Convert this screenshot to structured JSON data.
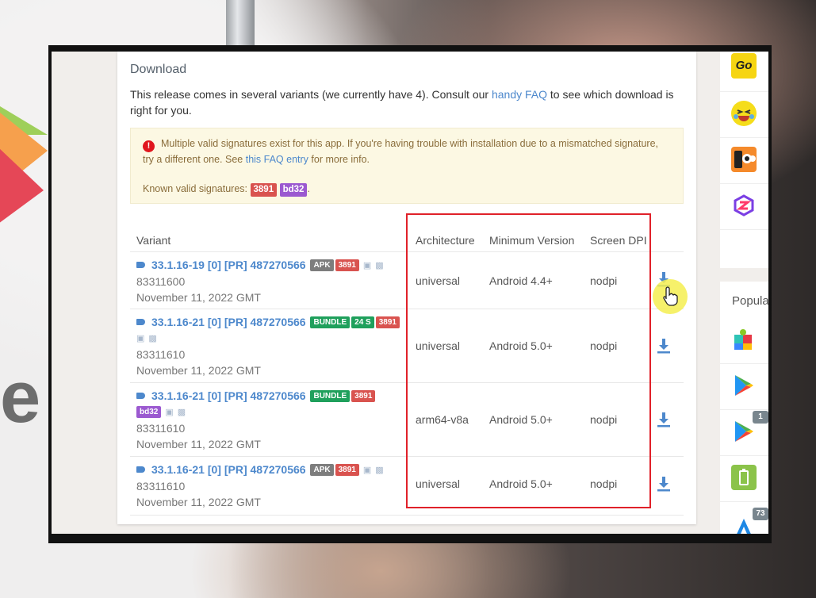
{
  "download": {
    "title": "Download",
    "intro_pre": "This release comes in several variants (we currently have 4). Consult our ",
    "intro_link": "handy FAQ",
    "intro_post": " to see which download is right for you.",
    "alert": {
      "icon": "exclamation-icon",
      "text_pre": "Multiple valid signatures exist for this app. If you're having trouble with installation due to a mismatched signature, try a different one. See ",
      "link": "this FAQ entry",
      "text_post": " for more info.",
      "known_label": "Known valid signatures:",
      "signatures": [
        "3891",
        "bd32"
      ],
      "period": "."
    }
  },
  "table": {
    "headers": {
      "variant": "Variant",
      "architecture": "Architecture",
      "min_version": "Minimum Version",
      "dpi": "Screen DPI"
    },
    "rows": [
      {
        "version": "33.1.16-19 [0] [PR] 487270566",
        "badges": [
          "APK",
          "3891"
        ],
        "code": "83311600",
        "date": "November 11, 2022 GMT",
        "architecture": "universal",
        "min_version": "Android 4.4+",
        "dpi": "nodpi"
      },
      {
        "version": "33.1.16-21 [0] [PR] 487270566",
        "badges": [
          "BUNDLE",
          "24 S",
          "3891"
        ],
        "code": "83311610",
        "date": "November 11, 2022 GMT",
        "architecture": "universal",
        "min_version": "Android 5.0+",
        "dpi": "nodpi"
      },
      {
        "version": "33.1.16-21 [0] [PR] 487270566",
        "badges": [
          "BUNDLE",
          "3891",
          "bd32"
        ],
        "code": "83311610",
        "date": "November 11, 2022 GMT",
        "architecture": "arm64-v8a",
        "min_version": "Android 5.0+",
        "dpi": "nodpi"
      },
      {
        "version": "33.1.16-21 [0] [PR] 487270566",
        "badges": [
          "APK",
          "3891"
        ],
        "code": "83311610",
        "date": "November 11, 2022 GMT",
        "architecture": "universal",
        "min_version": "Android 5.0+",
        "dpi": "nodpi"
      }
    ]
  },
  "sidebar": {
    "top_icons": [
      "go-app-icon",
      "laughing-emoji-app-icon",
      "camera-app-icon",
      "s-logo-app-icon"
    ],
    "top_go_label": "Go",
    "popular_title": "Popula",
    "popular_icons": [
      "puzzle-app-icon",
      "play-store-icon",
      "play-store-icon",
      "battery-app-icon",
      "arrow-app-icon"
    ],
    "badges": [
      "1",
      "73"
    ]
  },
  "background": {
    "letter": "e"
  },
  "colors": {
    "link": "#4d88cc",
    "highlight_box": "#e02129",
    "badge_red": "#d9534f",
    "badge_green": "#1fa05c",
    "badge_purple": "#9b59d0",
    "badge_gray": "#7d7d7d",
    "alert_bg": "#fcf8e3"
  }
}
